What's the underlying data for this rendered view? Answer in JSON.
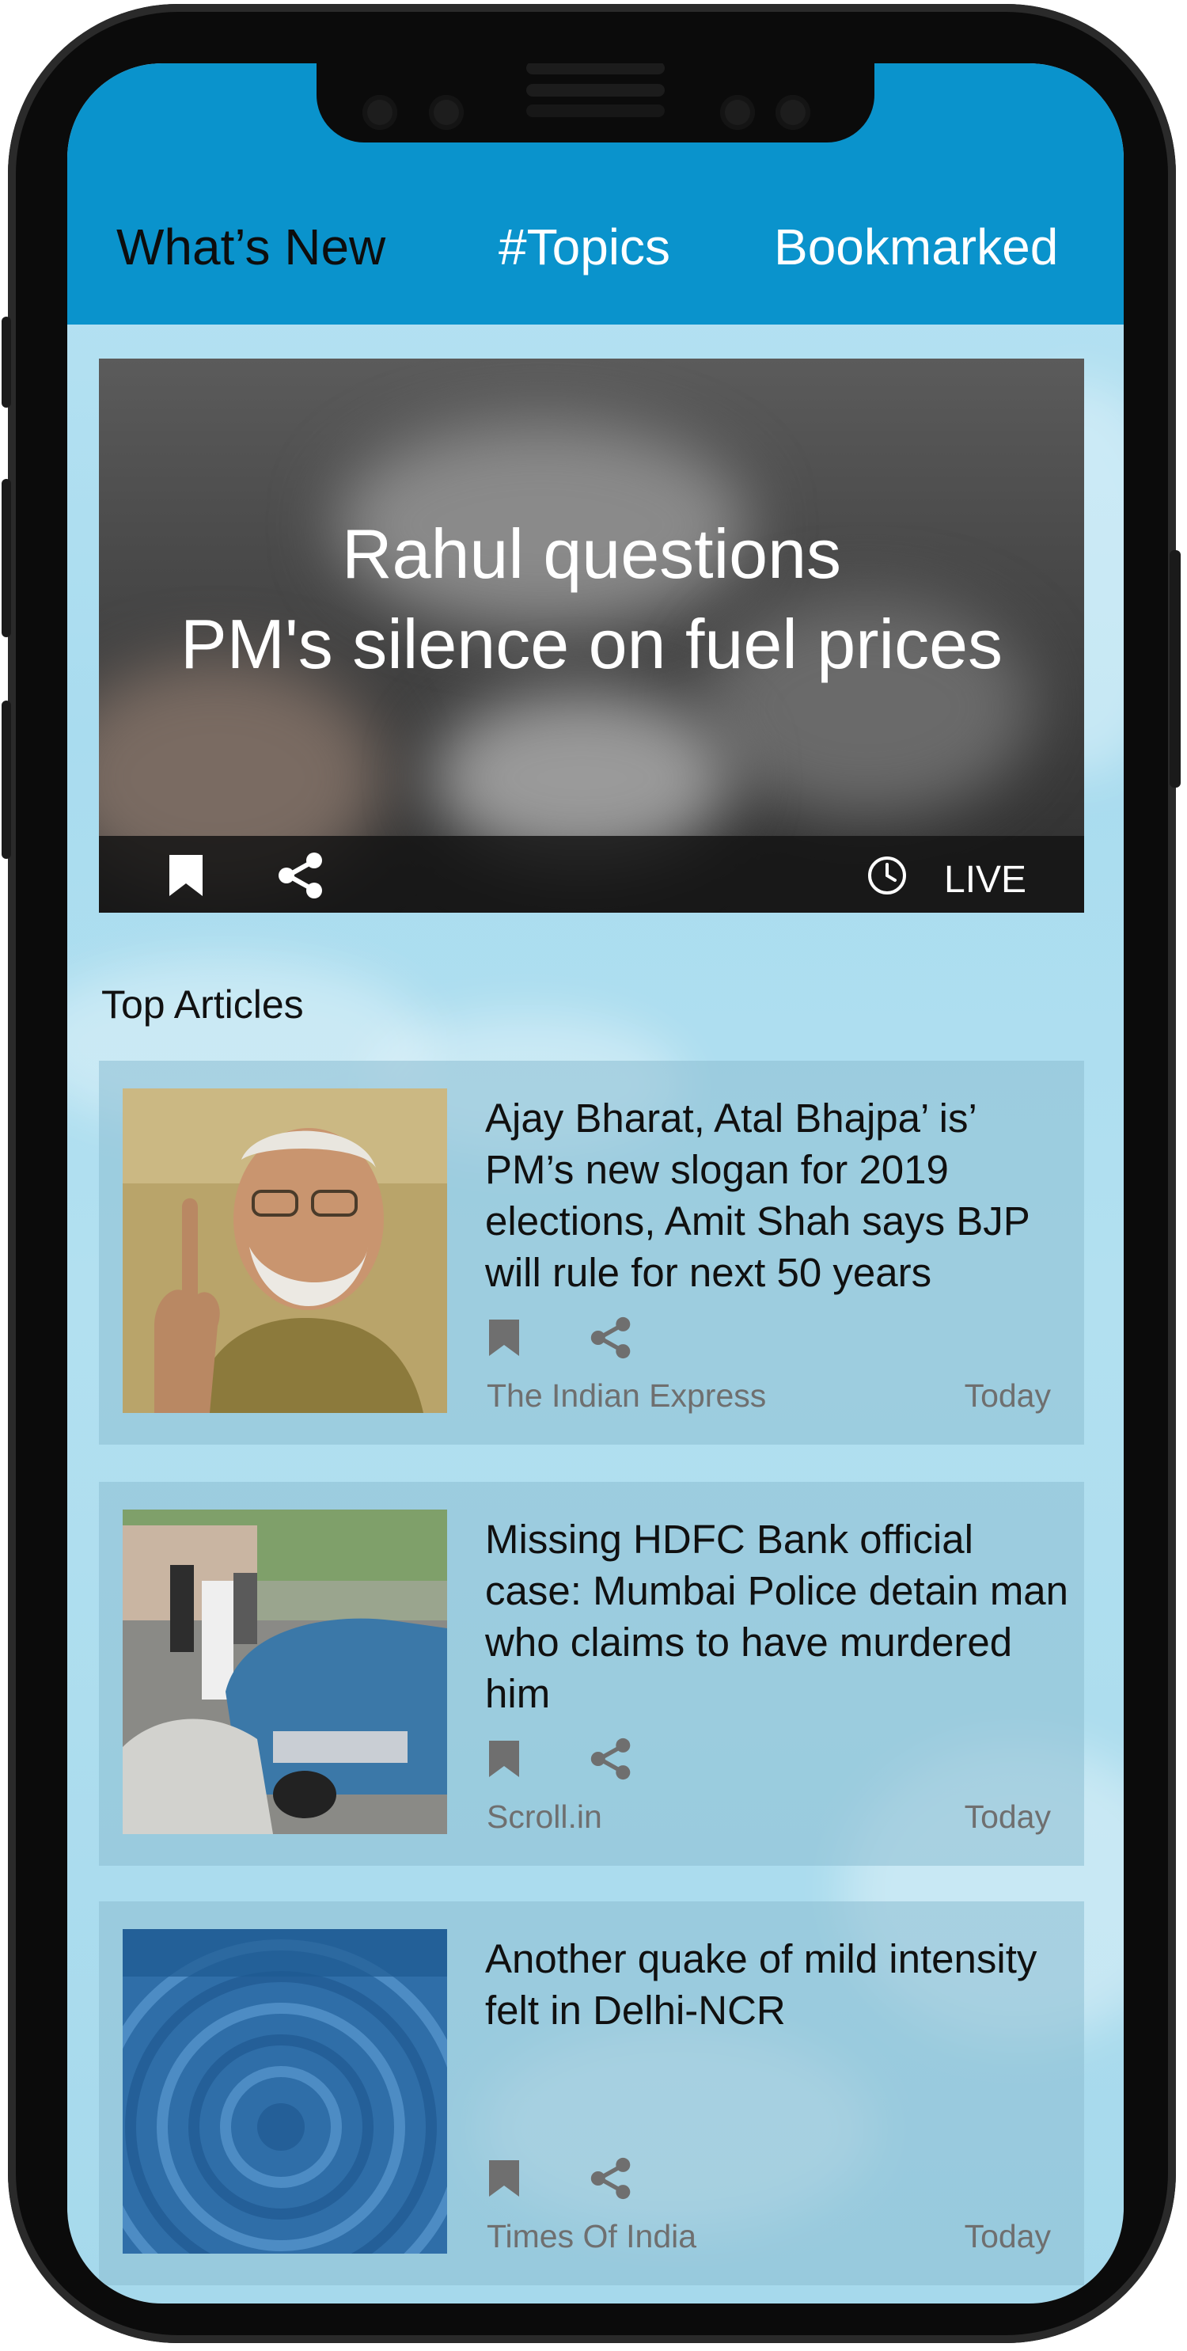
{
  "tabs": [
    {
      "label": "What’s New",
      "active": true
    },
    {
      "label": "#Topics",
      "active": false
    },
    {
      "label": "Bookmarked",
      "active": false
    }
  ],
  "hero": {
    "title_line1": "Rahul questions",
    "title_line2": "PM's silence on fuel prices",
    "status": "LIVE",
    "icons": [
      "bookmark-icon",
      "share-icon",
      "clock-icon"
    ]
  },
  "section_title": "Top Articles",
  "articles": [
    {
      "title": "Ajay Bharat, Atal Bhajpa’ is’ PM’s new slogan for 2019 elections, Amit Shah says BJP will rule for next 50 years",
      "source": "The Indian Express",
      "time": "Today"
    },
    {
      "title": "Missing HDFC Bank official case: Mumbai Police detain man who claims to have murdered him",
      "source": "Scroll.in",
      "time": "Today"
    },
    {
      "title": "Another quake of mild intensity felt in Delhi-NCR",
      "source": "Times Of India",
      "time": "Today"
    }
  ],
  "colors": {
    "header": "#0a93cc",
    "background": "#b2e0f0",
    "card": "#8cbed2",
    "muted_text": "#6f6f6f"
  }
}
